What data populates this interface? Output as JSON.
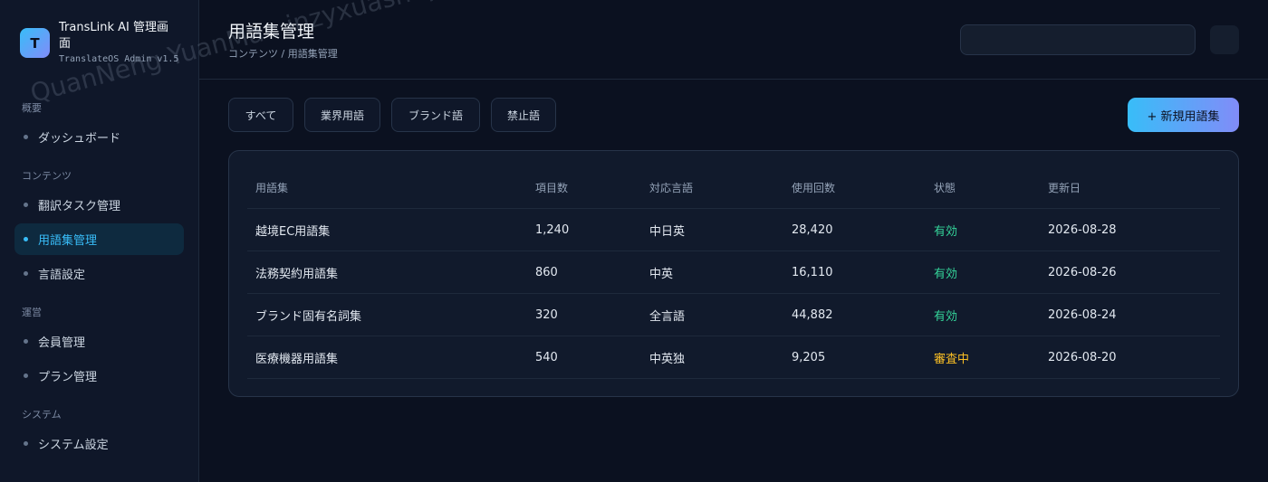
{
  "brand": {
    "logo_letter": "T",
    "title": "TransLink AI 管理画面",
    "subtitle": "TranslateOS Admin v1.5"
  },
  "sidebar": {
    "sections": [
      {
        "label": "概要",
        "items": [
          {
            "label": "ダッシュボード",
            "active": false
          }
        ]
      },
      {
        "label": "コンテンツ",
        "items": [
          {
            "label": "翻訳タスク管理",
            "active": false
          },
          {
            "label": "用語集管理",
            "active": true
          },
          {
            "label": "言語設定",
            "active": false
          }
        ]
      },
      {
        "label": "運営",
        "items": [
          {
            "label": "会員管理",
            "active": false
          },
          {
            "label": "プラン管理",
            "active": false
          }
        ]
      },
      {
        "label": "システム",
        "items": [
          {
            "label": "システム設定",
            "active": false
          }
        ]
      }
    ]
  },
  "header": {
    "title": "用語集管理",
    "breadcrumb": "コンテンツ / 用語集管理",
    "search": {
      "value": "",
      "placeholder": ""
    }
  },
  "filters": [
    "すべて",
    "業界用語",
    "ブランド語",
    "禁止語"
  ],
  "new_button_label": "+ 新規用語集",
  "table": {
    "columns": [
      "用語集",
      "項目数",
      "対応言語",
      "使用回数",
      "状態",
      "更新日"
    ],
    "rows": [
      [
        "越境EC用語集",
        "1,240",
        "中日英",
        "28,420",
        "有効",
        "2026-08-28"
      ],
      [
        "法務契約用語集",
        "860",
        "中英",
        "16,110",
        "有効",
        "2026-08-26"
      ],
      [
        "ブランド固有名詞集",
        "320",
        "全言語",
        "44,882",
        "有効",
        "2026-08-24"
      ],
      [
        "医療機器用語集",
        "540",
        "中英独",
        "9,205",
        "審査中",
        "2026-08-20"
      ]
    ]
  },
  "colors": {
    "accent": "#38bdf8",
    "accent_secondary": "#818cf8",
    "status_active": "#34d399",
    "status_review": "#fbbf24",
    "background": "#0b1120"
  },
  "watermark": "QuanNeng YuanMa : inzyxuashop.com"
}
